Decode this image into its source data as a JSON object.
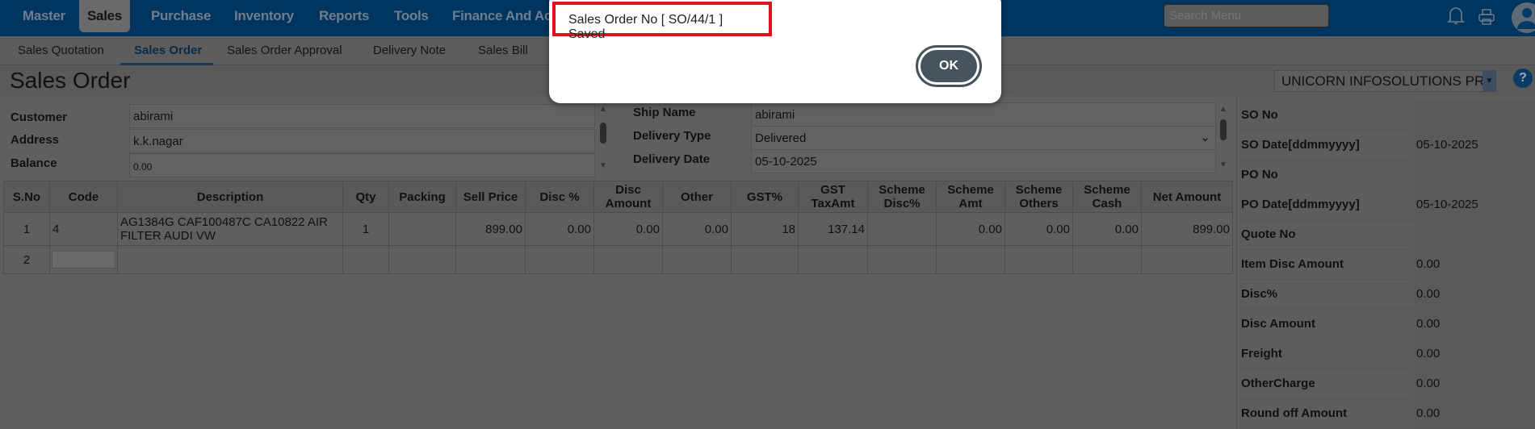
{
  "nav": {
    "items": [
      "Master",
      "Sales",
      "Purchase",
      "Inventory",
      "Reports",
      "Tools",
      "Finance And Acc"
    ],
    "active": "Sales",
    "search_placeholder": "Search Menu"
  },
  "subnav": {
    "items": [
      "Sales Quotation",
      "Sales Order",
      "Sales Order Approval",
      "Delivery Note",
      "Sales Bill"
    ],
    "active": "Sales Order"
  },
  "page": {
    "title": "Sales Order",
    "company": "UNICORN INFOSOLUTIONS PR"
  },
  "form_left": {
    "customer_label": "Customer",
    "customer": "abirami",
    "address_label": "Address",
    "address": "k.k.nagar",
    "balance_label": "Balance",
    "balance": "0.00"
  },
  "form_right": {
    "ship_name_label": "Ship Name",
    "ship_name": "abirami",
    "delivery_type_label": "Delivery Type",
    "delivery_type": "Delivered",
    "delivery_date_label": "Delivery Date",
    "delivery_date": "05-10-2025"
  },
  "table": {
    "headers": [
      "S.No",
      "Code",
      "Description",
      "Qty",
      "Packing",
      "Sell Price",
      "Disc %",
      "Disc Amount",
      "Other",
      "GST%",
      "GST TaxAmt",
      "Scheme Disc%",
      "Scheme Amt",
      "Scheme Others",
      "Scheme Cash",
      "Net Amount"
    ],
    "rows": [
      [
        "1",
        "4",
        "AG1384G CAF100487C CA10822 AIR FILTER AUDI VW",
        "1",
        "",
        "899.00",
        "0.00",
        "0.00",
        "0.00",
        "18",
        "137.14",
        "",
        "0.00",
        "0.00",
        "0.00",
        "899.00"
      ],
      [
        "2",
        "",
        "",
        "",
        "",
        "",
        "",
        "",
        "",
        "",
        "",
        "",
        "",
        "",
        "",
        ""
      ]
    ]
  },
  "summary": [
    [
      "SO No",
      ""
    ],
    [
      "SO Date[ddmmyyyy]",
      "05-10-2025"
    ],
    [
      "PO No",
      ""
    ],
    [
      "PO Date[ddmmyyyy]",
      "05-10-2025"
    ],
    [
      "Quote No",
      ""
    ],
    [
      "Item Disc Amount",
      "0.00"
    ],
    [
      "Disc%",
      "0.00"
    ],
    [
      "Disc Amount",
      "0.00"
    ],
    [
      "Freight",
      "0.00"
    ],
    [
      "OtherCharge",
      "0.00"
    ],
    [
      "Round off Amount",
      "0.00"
    ]
  ],
  "dialog": {
    "message": "Sales Order No [ SO/44/1 ] Saved",
    "ok_label": "OK"
  },
  "colors": {
    "nav": "#00355f",
    "alert_border": "#e0101e",
    "ok_button": "#45545d"
  }
}
